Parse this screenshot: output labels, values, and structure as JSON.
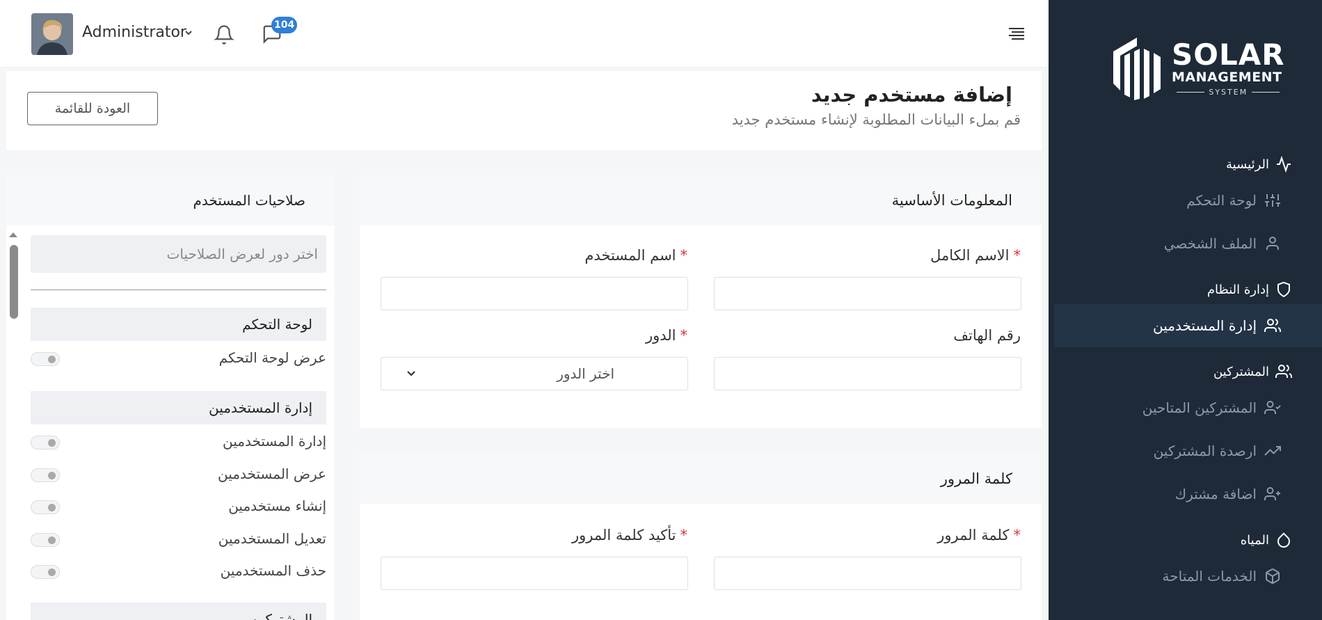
{
  "brand": {
    "line1": "SOLAR",
    "line2": "MANAGEMENT",
    "line3": "SYSTEM",
    "background": "#1e2a38"
  },
  "topbar": {
    "user_name": "Administrator",
    "chat_badge": "104",
    "icons": [
      "chevron-down-icon",
      "bell-icon",
      "chat-icon",
      "menu-toggle-icon"
    ]
  },
  "sidebar": {
    "sections": [
      {
        "label": "الرئيسية",
        "icon": "activity-icon",
        "items": [
          {
            "label": "لوحة التحكم",
            "icon": "sliders-icon"
          },
          {
            "label": "الملف الشخصي",
            "icon": "user-icon"
          }
        ]
      },
      {
        "label": "إدارة النظام",
        "icon": "shield-icon",
        "items": [
          {
            "label": "إدارة المستخدمين",
            "icon": "users-icon",
            "active": true
          }
        ]
      },
      {
        "label": "المشتركين",
        "icon": "users-icon",
        "items": [
          {
            "label": "المشتركين المتاحين",
            "icon": "user-check-icon"
          },
          {
            "label": "ارصدة المشتركين",
            "icon": "trending-up-icon"
          },
          {
            "label": "اضافة مشترك",
            "icon": "user-plus-icon"
          }
        ]
      },
      {
        "label": "المياه",
        "icon": "droplet-icon",
        "items": [
          {
            "label": "الخدمات المتاحة",
            "icon": "box-icon"
          }
        ]
      }
    ]
  },
  "header": {
    "title": "إضافة مستخدم جديد",
    "subtitle": "قم بملء البيانات المطلوبة لإنشاء مستخدم جديد",
    "back_button": "العودة للقائمة"
  },
  "permissions": {
    "title": "صلاحيات المستخدم",
    "role_placeholder": "اختر دور لعرض الصلاحيات",
    "groups": [
      {
        "title": "لوحة التحكم",
        "items": [
          "عرض لوحة التحكم"
        ]
      },
      {
        "title": "إدارة المستخدمين",
        "items": [
          "إدارة المستخدمين",
          "عرض المستخدمين",
          "إنشاء مستخدمين",
          "تعديل المستخدمين",
          "حذف المستخدمين"
        ]
      },
      {
        "title": "المشتركين",
        "items": []
      }
    ]
  },
  "basic_info": {
    "title": "المعلومات الأساسية",
    "full_name_label": "الاسم الكامل",
    "username_label": "اسم المستخدم",
    "phone_label": "رقم الهاتف",
    "role_label": "الدور",
    "role_value": "اختر الدور",
    "required_mark": "*"
  },
  "password": {
    "title": "كلمة المرور",
    "password_label": "كلمة المرور",
    "confirm_label": "تأكيد كلمة المرور",
    "required_mark": "*"
  },
  "colors": {
    "accent": "#2f7fd8",
    "required": "#d9363e",
    "sidebar_active": "#243447"
  }
}
